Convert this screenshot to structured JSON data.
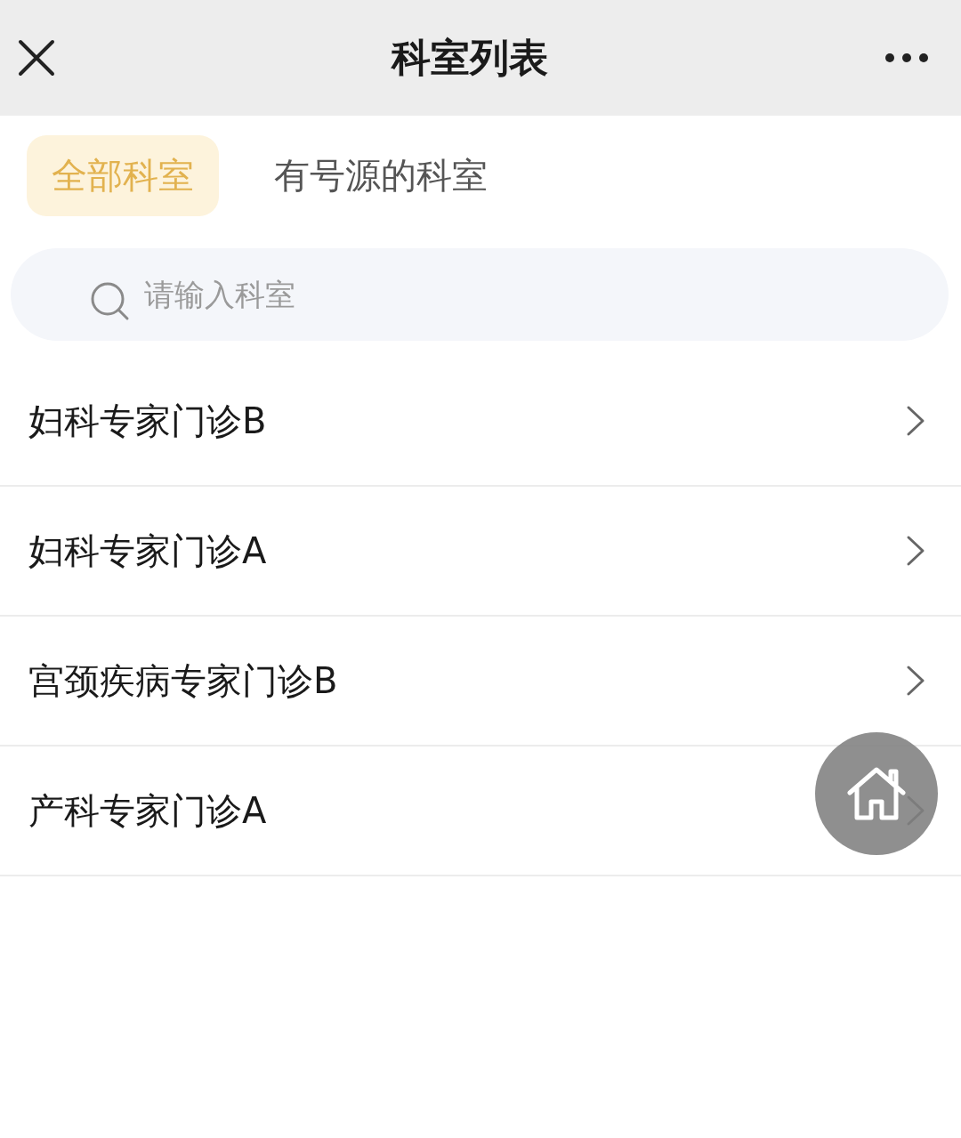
{
  "header": {
    "title": "科室列表"
  },
  "tabs": [
    {
      "label": "全部科室",
      "selected": true
    },
    {
      "label": "有号源的科室",
      "selected": false
    }
  ],
  "search": {
    "placeholder": "请输入科室"
  },
  "departments": [
    {
      "name": "妇科专家门诊B"
    },
    {
      "name": "妇科专家门诊A"
    },
    {
      "name": "宫颈疾病专家门诊B"
    },
    {
      "name": "产科专家门诊A"
    }
  ]
}
